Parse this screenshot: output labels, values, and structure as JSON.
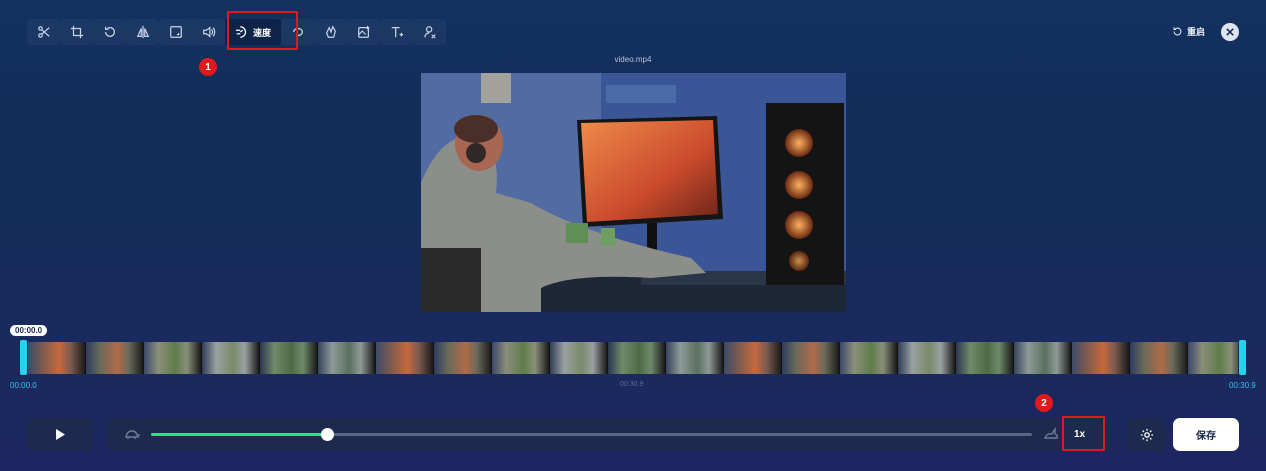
{
  "toolbar": {
    "tools": [
      {
        "icon": "scissors-icon"
      },
      {
        "icon": "crop-icon"
      },
      {
        "icon": "rotate-icon"
      },
      {
        "icon": "flip-icon"
      },
      {
        "icon": "resize-icon"
      },
      {
        "icon": "volume-icon"
      },
      {
        "icon": "speed-icon",
        "label": "速度"
      },
      {
        "icon": "loop-icon"
      },
      {
        "icon": "sticker-icon"
      },
      {
        "icon": "image-add-icon"
      },
      {
        "icon": "text-add-icon"
      },
      {
        "icon": "watermark-remove-icon"
      }
    ],
    "reset_label": "重启"
  },
  "annotations": {
    "marker_1": "1",
    "marker_2": "2",
    "color": "#e0191b"
  },
  "video": {
    "filename": "video.mp4"
  },
  "timeline": {
    "current_time": "00:00.0",
    "start_time": "00:00.0",
    "mid_time": "00:30.9",
    "end_time": "00:30.9"
  },
  "speed": {
    "value_label": "1x",
    "slider_fraction": 0.2
  },
  "actions": {
    "save_label": "保存"
  },
  "colors": {
    "accent_green": "#27e58a",
    "accent_cyan": "#25d3ef",
    "background": "#142c5a"
  }
}
